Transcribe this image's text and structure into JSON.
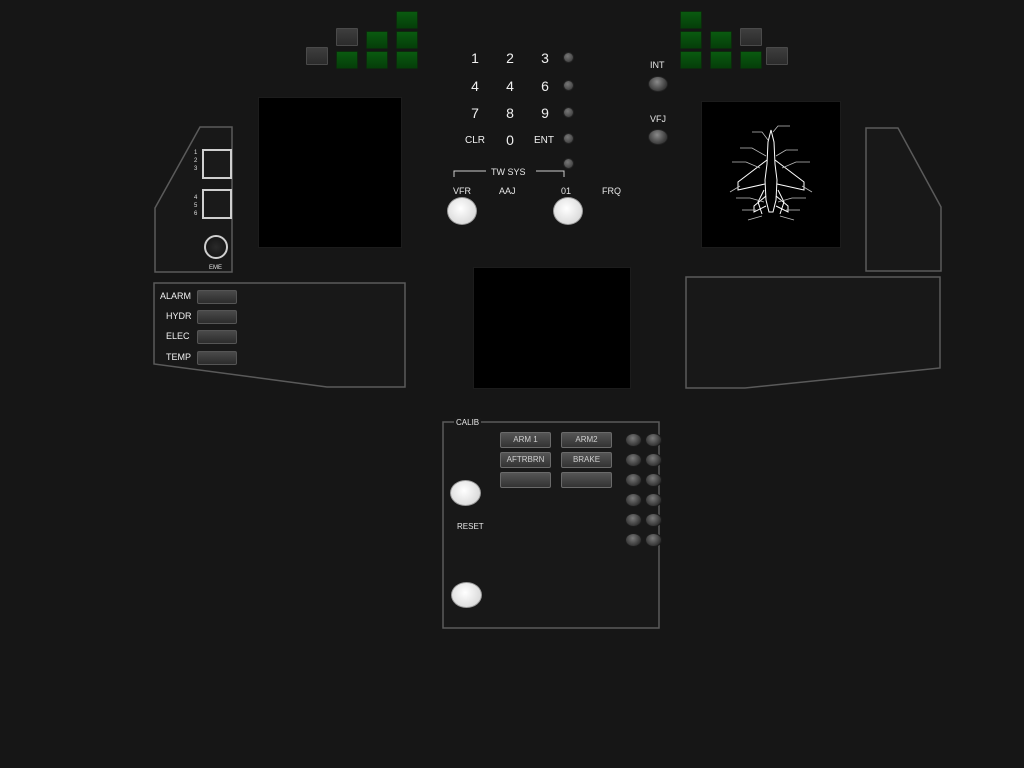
{
  "keypad": {
    "keys": [
      "1",
      "2",
      "3",
      "4",
      "4",
      "6",
      "7",
      "8",
      "9",
      "CLR",
      "0",
      "ENT"
    ]
  },
  "right_top": {
    "int_label": "INT",
    "vfj_label": "VFJ"
  },
  "tw_sys": {
    "title": "TW SYS",
    "vfr_label": "VFR",
    "aaj_label": "AAJ",
    "ch_label": "01",
    "frq_label": "FRQ"
  },
  "left_panel": {
    "group1_digits": [
      "1",
      "2",
      "3"
    ],
    "group2_digits": [
      "4",
      "5",
      "6"
    ],
    "eme_label": "EME"
  },
  "alarms": {
    "items": [
      "ALARM",
      "HYDR",
      "ELEC",
      "TEMP"
    ]
  },
  "bottom_panel": {
    "calib_label": "CALIB",
    "reset_label": "RESET",
    "buttons": [
      "ARM 1",
      "ARM2",
      "AFTRBRN",
      "BRAKE",
      "",
      ""
    ]
  },
  "colors": {
    "background": "#161616",
    "indicator_on": "#0a5a10",
    "indicator_off": "#3a3a3a"
  }
}
